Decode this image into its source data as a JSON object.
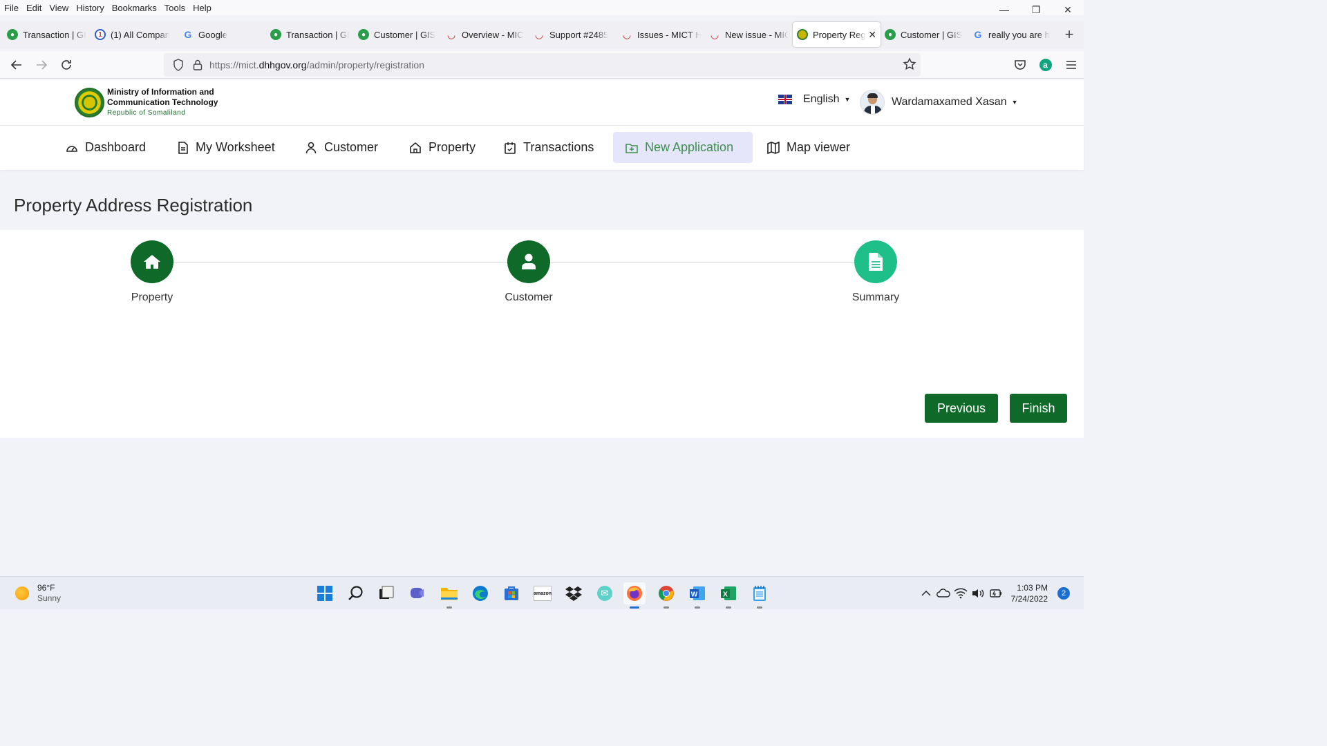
{
  "browser": {
    "menu": [
      "File",
      "Edit",
      "View",
      "History",
      "Bookmarks",
      "Tools",
      "Help"
    ],
    "tabs": [
      {
        "title": "Transaction | GI",
        "icon": "gis-icon"
      },
      {
        "title": "(1) All Compan",
        "icon": "company-icon"
      },
      {
        "title": "Google",
        "icon": "google-icon"
      },
      {
        "title": "Transaction | GI",
        "icon": "gis-icon"
      },
      {
        "title": "Customer | GIS",
        "icon": "gis-icon"
      },
      {
        "title": "Overview - MIC",
        "icon": "redmine-icon"
      },
      {
        "title": "Support #2485",
        "icon": "redmine-icon"
      },
      {
        "title": "Issues - MICT H",
        "icon": "redmine-icon"
      },
      {
        "title": "New issue - MIC",
        "icon": "redmine-icon"
      },
      {
        "title": "Property Reg",
        "icon": "mict-seal-icon",
        "active": true
      },
      {
        "title": "Customer | GIS",
        "icon": "gis-icon"
      },
      {
        "title": "really you are h",
        "icon": "google-icon"
      }
    ],
    "url": {
      "prefix": "https://mict.",
      "domain": "dhhgov.org",
      "path": "/admin/property/registration"
    }
  },
  "header": {
    "logo_line1": "Ministry of Information  and",
    "logo_line2": "Communication Technology",
    "logo_line3": "Republic of Somaliland",
    "language": "English",
    "user_name": "Wardamaxamed Xasan"
  },
  "nav": {
    "items": [
      {
        "label": "Dashboard",
        "icon": "dashboard-icon"
      },
      {
        "label": "My Worksheet",
        "icon": "worksheet-icon"
      },
      {
        "label": "Customer",
        "icon": "user-icon"
      },
      {
        "label": "Property",
        "icon": "home-icon"
      },
      {
        "label": "Transactions",
        "icon": "clipboard-icon"
      },
      {
        "label": "New Application",
        "icon": "folder-plus-icon",
        "active": true
      },
      {
        "label": "Map viewer",
        "icon": "map-icon"
      }
    ]
  },
  "page": {
    "title": "Property Address Registration",
    "steps": [
      {
        "label": "Property",
        "icon": "home-icon",
        "color": "#0f6a2a"
      },
      {
        "label": "Customer",
        "icon": "user-icon",
        "color": "#0f6a2a"
      },
      {
        "label": "Summary",
        "icon": "document-icon",
        "color": "#1fbf8a"
      }
    ],
    "buttons": {
      "previous": "Previous",
      "finish": "Finish"
    }
  },
  "taskbar": {
    "weather_temp": "96°F",
    "weather_desc": "Sunny",
    "time": "1:03 PM",
    "date": "7/24/2022",
    "notifications": "2"
  },
  "colors": {
    "primary": "#0f6a2a",
    "accent": "#1fbf8a",
    "active_nav_bg": "#e6e6fa"
  }
}
